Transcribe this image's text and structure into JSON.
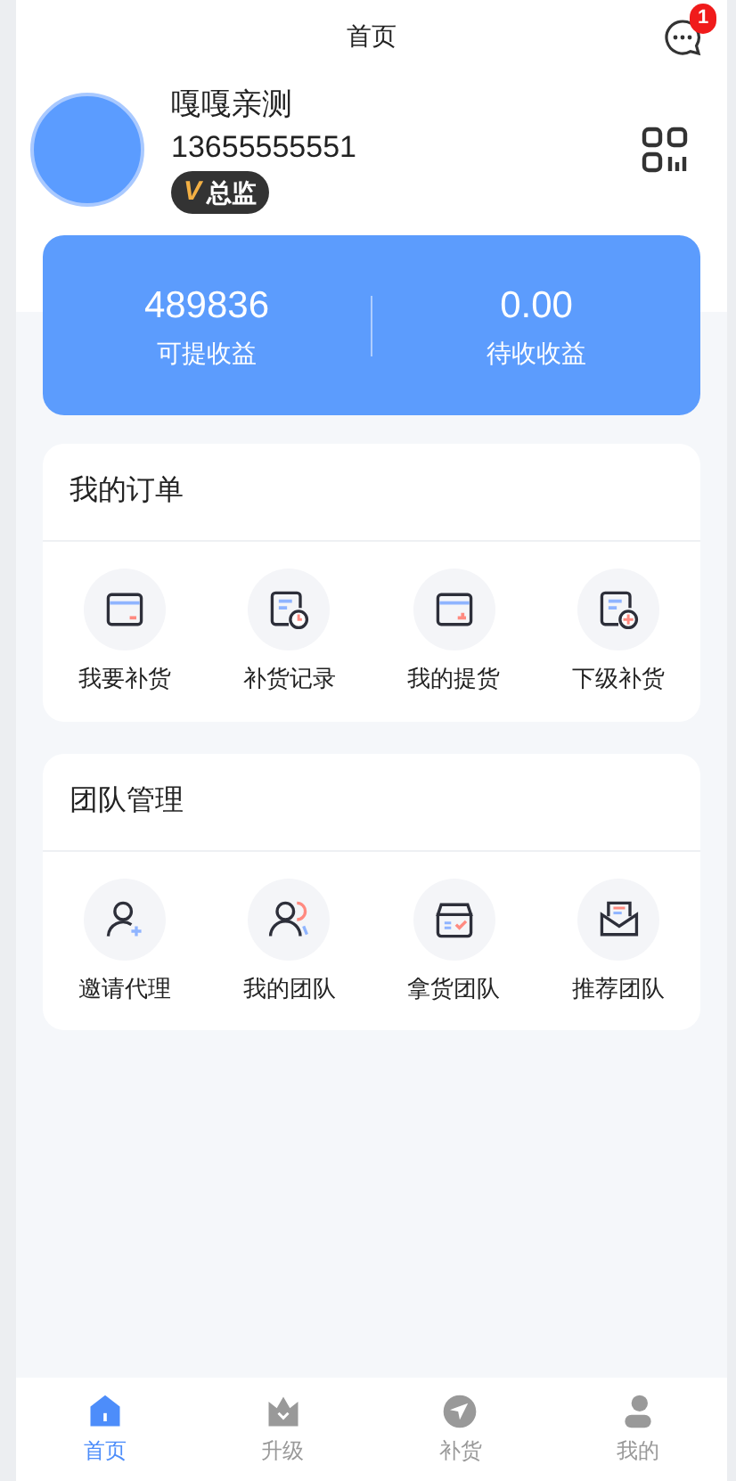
{
  "header": {
    "title": "首页",
    "message_badge": "1"
  },
  "profile": {
    "name": "嘎嘎亲测",
    "phone": "13655555551",
    "level_badge": {
      "icon": "V",
      "label": "总监"
    }
  },
  "earnings": [
    {
      "value": "489836",
      "label": "可提收益"
    },
    {
      "value": "0.00",
      "label": "待收收益"
    }
  ],
  "sections": [
    {
      "title": "我的订单",
      "items": [
        {
          "label": "我要补货",
          "kind": "card-minus"
        },
        {
          "label": "补货记录",
          "kind": "doc-clock"
        },
        {
          "label": "我的提货",
          "kind": "card-arrow"
        },
        {
          "label": "下级补货",
          "kind": "doc-plus"
        }
      ]
    },
    {
      "title": "团队管理",
      "items": [
        {
          "label": "邀请代理",
          "kind": "person-plus"
        },
        {
          "label": "我的团队",
          "kind": "people"
        },
        {
          "label": "拿货团队",
          "kind": "box"
        },
        {
          "label": "推荐团队",
          "kind": "envelope"
        }
      ]
    }
  ],
  "tabs": [
    {
      "label": "首页",
      "kind": "home",
      "selected": true
    },
    {
      "label": "升级",
      "kind": "crown",
      "selected": false
    },
    {
      "label": "补货",
      "kind": "send",
      "selected": false
    },
    {
      "label": "我的",
      "kind": "user",
      "selected": false
    }
  ]
}
